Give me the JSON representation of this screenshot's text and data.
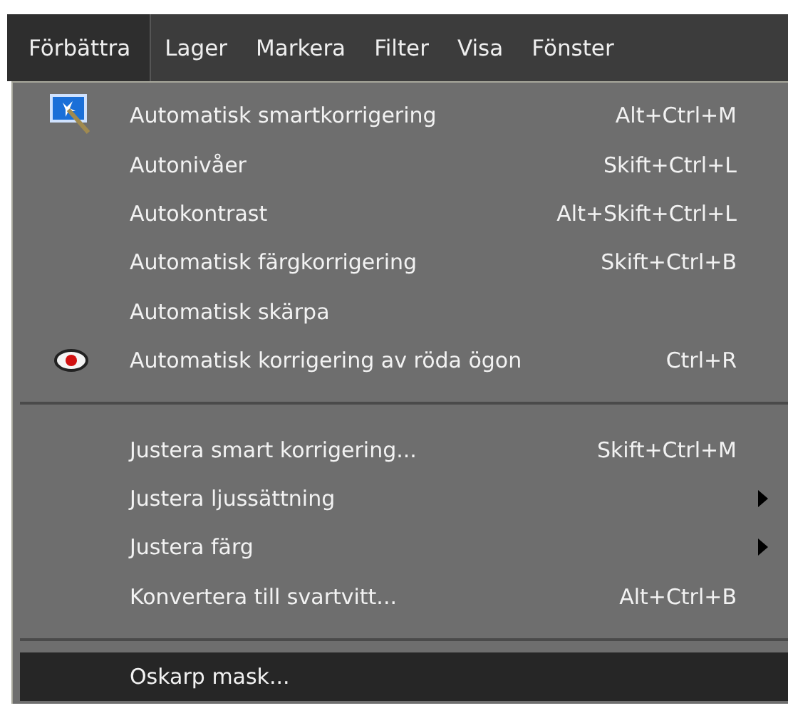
{
  "menubar": [
    {
      "label": "Förbättra",
      "selected": true
    },
    {
      "label": "Lager",
      "selected": false
    },
    {
      "label": "Markera",
      "selected": false
    },
    {
      "label": "Filter",
      "selected": false
    },
    {
      "label": "Visa",
      "selected": false
    },
    {
      "label": "Fönster",
      "selected": false
    }
  ],
  "menu": {
    "sections": [
      {
        "items": [
          {
            "label": "Automatisk smartkorrigering",
            "shortcut": "Alt+Ctrl+M",
            "kind": "wand",
            "submenu": false,
            "selected": false
          },
          {
            "label": "Autonivåer",
            "shortcut": "Skift+Ctrl+L",
            "kind": "plain",
            "submenu": false,
            "selected": false
          },
          {
            "label": "Autokontrast",
            "shortcut": "Alt+Skift+Ctrl+L",
            "kind": "plain",
            "submenu": false,
            "selected": false
          },
          {
            "label": "Automatisk färgkorrigering",
            "shortcut": "Skift+Ctrl+B",
            "kind": "plain",
            "submenu": false,
            "selected": false
          },
          {
            "label": "Automatisk skärpa",
            "kind": "plain",
            "submenu": false,
            "selected": false
          },
          {
            "label": "Automatisk korrigering av röda ögon",
            "shortcut": "Ctrl+R",
            "kind": "eye",
            "submenu": false,
            "selected": false
          }
        ]
      },
      {
        "items": [
          {
            "label": "Justera smart korrigering...",
            "shortcut": "Skift+Ctrl+M",
            "kind": "plain",
            "submenu": false,
            "selected": false
          },
          {
            "label": "Justera ljussättning",
            "kind": "plain",
            "submenu": true,
            "selected": false
          },
          {
            "label": "Justera färg",
            "kind": "plain",
            "submenu": true,
            "selected": false
          },
          {
            "label": "Konvertera till svartvitt...",
            "shortcut": "Alt+Ctrl+B",
            "kind": "plain",
            "submenu": false,
            "selected": false
          }
        ]
      },
      {
        "items": [
          {
            "label": "Oskarp mask...",
            "kind": "plain",
            "submenu": false,
            "selected": true
          }
        ]
      }
    ]
  }
}
